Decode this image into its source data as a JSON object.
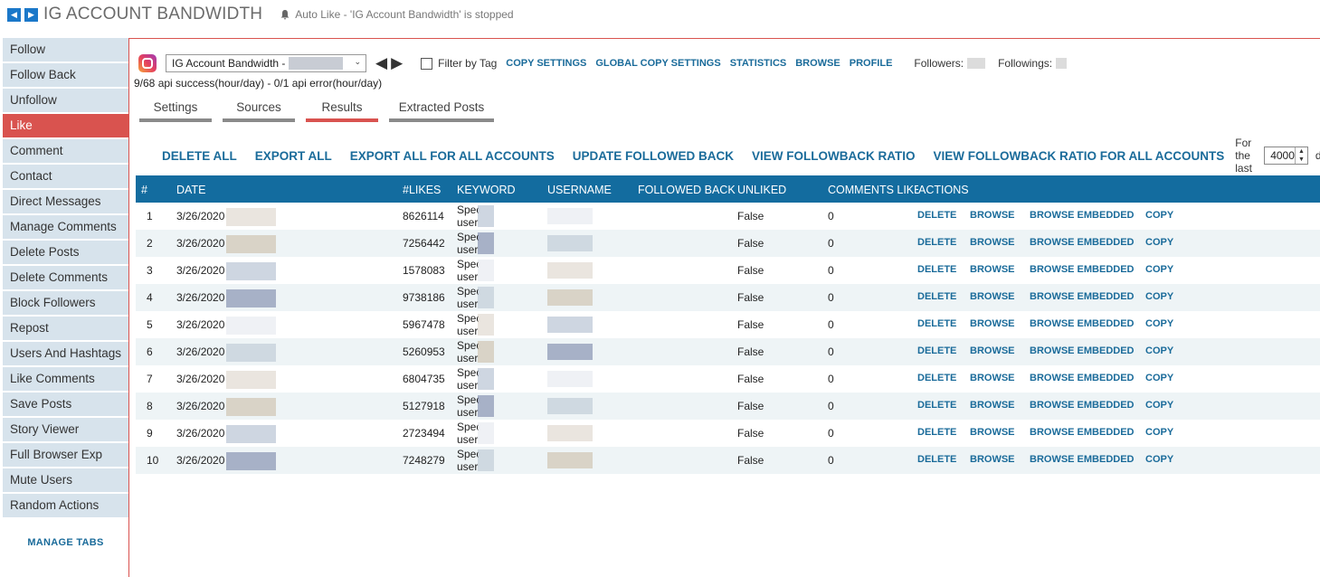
{
  "header": {
    "title": "IG ACCOUNT BANDWIDTH",
    "status": "Auto Like - 'IG Account Bandwidth' is stopped"
  },
  "sidebar": {
    "items": [
      "Follow",
      "Follow Back",
      "Unfollow",
      "Like",
      "Comment",
      "Contact",
      "Direct Messages",
      "Manage Comments",
      "Delete Posts",
      "Delete Comments",
      "Block Followers",
      "Repost",
      "Users And Hashtags",
      "Like Comments",
      "Save Posts",
      "Story Viewer",
      "Full Browser Exp",
      "Mute Users",
      "Random Actions"
    ],
    "active": "Like",
    "manage_tabs": "MANAGE TABS"
  },
  "account": {
    "selected": "IG Account Bandwidth -",
    "filter_label": "Filter by Tag",
    "links": [
      "COPY SETTINGS",
      "GLOBAL COPY SETTINGS",
      "STATISTICS",
      "BROWSE",
      "PROFILE"
    ],
    "followers_label": "Followers:",
    "followings_label": "Followings:",
    "api_line": "9/68 api success(hour/day) -  0/1 api error(hour/day)"
  },
  "tabs": [
    {
      "label": "Settings",
      "active": false
    },
    {
      "label": "Sources",
      "active": false
    },
    {
      "label": "Results",
      "active": true
    },
    {
      "label": "Extracted Posts",
      "active": false
    }
  ],
  "actions": {
    "delete_all": "DELETE ALL",
    "export_all": "EXPORT ALL",
    "export_all_accounts": "EXPORT ALL FOR ALL ACCOUNTS",
    "update_followed_back": "UPDATE FOLLOWED BACK",
    "view_ratio": "VIEW FOLLOWBACK RATIO",
    "view_ratio_all": "VIEW FOLLOWBACK RATIO FOR ALL ACCOUNTS",
    "for_last_label": "For the last",
    "days_value": "4000",
    "days_label": "days"
  },
  "grid": {
    "columns": [
      "#",
      "DATE",
      "#LIKES",
      "KEYWORD",
      "USERNAME",
      "FOLLOWED BACK",
      "UNLIKED",
      "COMMENTS LIKE",
      "ACTIONS"
    ],
    "row_links": [
      "DELETE",
      "BROWSE",
      "BROWSE EMBEDDED",
      "COPY"
    ],
    "rows": [
      {
        "num": "1",
        "date": "3/26/2020",
        "likes": "8626114",
        "keyword": "Spec user",
        "unliked": "False",
        "comments": "0"
      },
      {
        "num": "2",
        "date": "3/26/2020",
        "likes": "7256442",
        "keyword": "Spec user",
        "unliked": "False",
        "comments": "0"
      },
      {
        "num": "3",
        "date": "3/26/2020",
        "likes": "1578083",
        "keyword": "Spec user",
        "unliked": "False",
        "comments": "0"
      },
      {
        "num": "4",
        "date": "3/26/2020",
        "likes": "9738186",
        "keyword": "Spec user",
        "unliked": "False",
        "comments": "0"
      },
      {
        "num": "5",
        "date": "3/26/2020",
        "likes": "5967478",
        "keyword": "Spec user",
        "unliked": "False",
        "comments": "0"
      },
      {
        "num": "6",
        "date": "3/26/2020",
        "likes": "5260953",
        "keyword": "Spec user",
        "unliked": "False",
        "comments": "0"
      },
      {
        "num": "7",
        "date": "3/26/2020",
        "likes": "6804735",
        "keyword": "Spec user",
        "unliked": "False",
        "comments": "0"
      },
      {
        "num": "8",
        "date": "3/26/2020",
        "likes": "5127918",
        "keyword": "Spec user",
        "unliked": "False",
        "comments": "0"
      },
      {
        "num": "9",
        "date": "3/26/2020",
        "likes": "2723494",
        "keyword": "Spec user",
        "unliked": "False",
        "comments": "0"
      },
      {
        "num": "10",
        "date": "3/26/2020",
        "likes": "7248279",
        "keyword": "Spec user",
        "unliked": "False",
        "comments": "0"
      }
    ]
  },
  "colors": {
    "accent": "#136c9f",
    "active": "#d9534f",
    "link": "#1a6b9a",
    "sidebar_bg": "#d7e3ec"
  }
}
